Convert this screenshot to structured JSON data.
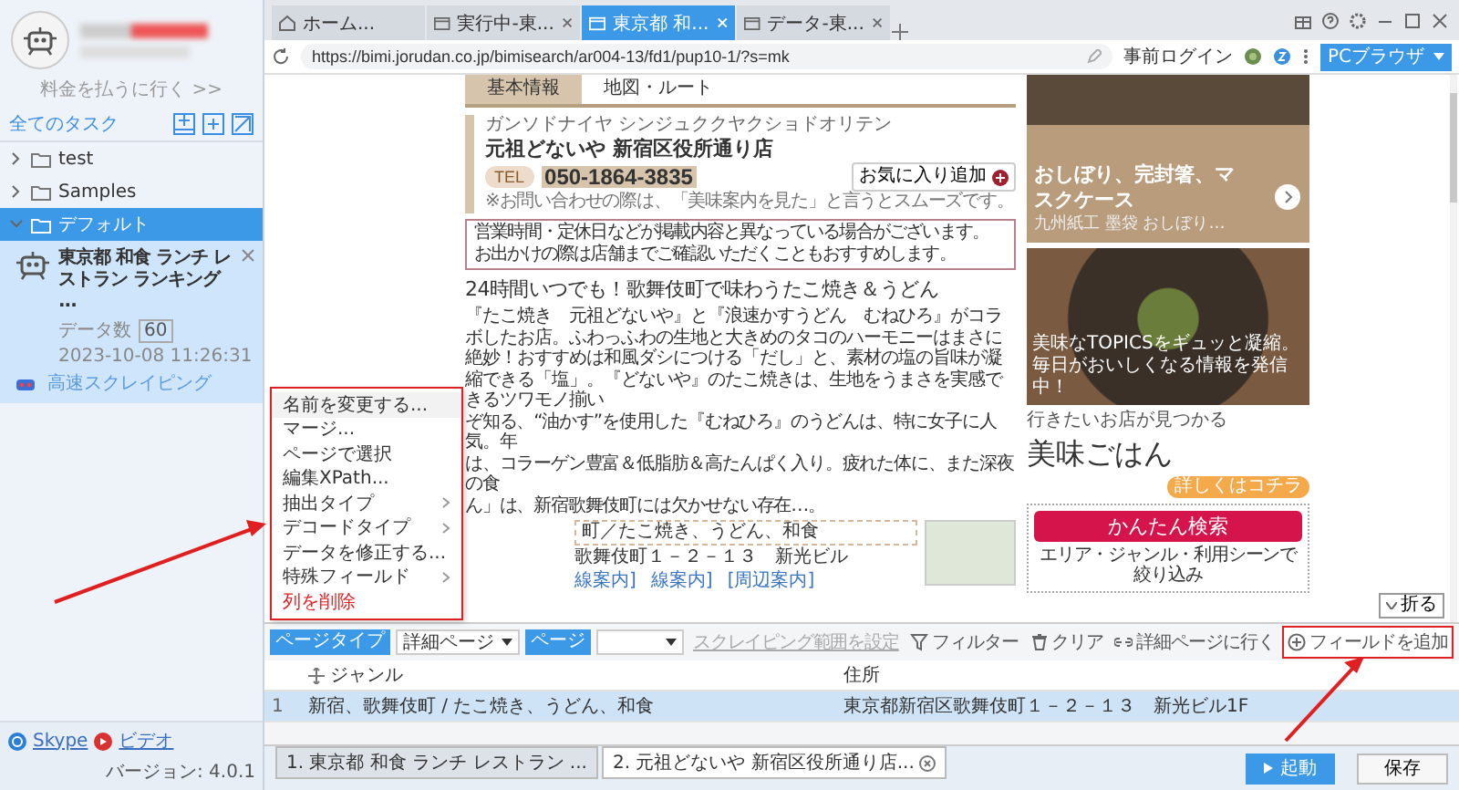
{
  "sidebar": {
    "upgrade_link": "料金を払うに行く >>",
    "all_tasks": "全てのタスク",
    "tree": [
      {
        "label": "test",
        "expanded": false,
        "selected": false
      },
      {
        "label": "Samples",
        "expanded": false,
        "selected": false
      },
      {
        "label": "デフォルト",
        "expanded": true,
        "selected": true,
        "children": [
          {
            "title": "東京都 和食 ランチ レストラン ランキング ...",
            "data_label": "データ数",
            "data_count": "60",
            "time": "2023-10-08 11:26:31",
            "mode": "高速スクレイピング"
          }
        ]
      }
    ],
    "footer": {
      "skype": "Skype",
      "video": "ビデオ",
      "version": "バージョン: 4.0.1"
    }
  },
  "browser": {
    "tabs": [
      {
        "label": "ホーム...",
        "kind": "home",
        "selected": false,
        "closable": false
      },
      {
        "label": "実行中-東...",
        "kind": "page",
        "selected": false,
        "closable": true
      },
      {
        "label": "東京都 和...",
        "kind": "page",
        "selected": true,
        "closable": true
      },
      {
        "label": "データ-東...",
        "kind": "page",
        "selected": false,
        "closable": true
      }
    ],
    "url": "https://bimi.jorudan.co.jp/bimisearch/ar004-13/fd1/pup10-1/?s=mk",
    "prelogin": "事前ログイン",
    "mode_button": "PCブラウザ"
  },
  "page": {
    "tabs": [
      {
        "label": "基本情報",
        "selected": true
      },
      {
        "label": "地図・ルート",
        "selected": false
      }
    ],
    "kana": "ガンソドナイヤ シンジュククヤクショドオリテン",
    "name": "元祖どないや 新宿区役所通り店",
    "tel_label": "TEL",
    "tel": "050-1864-3835",
    "tel_note": "※お問い合わせの際は、「美味案内を見た」と言うとスムーズです。",
    "favorite_button": "お気に入り追加",
    "notice": [
      "営業時間・定休日などが掲載内容と異なっている場合がございます。",
      "お出かけの際は店舗までご確認いただくこともおすすめします。"
    ],
    "headline": "24時間いつでも！歌舞伎町で味わうたこ焼き＆うどん",
    "description": "『たこ焼き　元祖どないや』と『浪速かすうどん　むねひろ』がコラボしたお店。ふわっふわの生地と大きめのタコのハーモニーはまさに絶妙！おすすめは和風ダシにつける「だし」と、素材の塩の旨味が凝縮できる「塩」。『どないや』のたこ焼きは、生地をうまさを実感できるツワモノ揃い",
    "description_fragments": [
      "ぞ知る、“油かす”を使用した『むねひろ』のうどんは、特に女子に人気。年",
      "は、コラーゲン豊富＆低脂肪＆高たんぱく入り。疲れた体に、また深夜の食",
      "ん」は、新宿歌舞伎町には欠かせない存在…。"
    ],
    "info": {
      "genre": "町／たこ焼き、うどん、和食",
      "address": "歌舞伎町１－２－１３　新光ビル",
      "links": [
        "線案内]",
        "線案内]",
        "[周辺案内]"
      ]
    },
    "promo": {
      "title": "おしぼり、完封箸、マスクケース",
      "subtitle": "九州紙工 墨袋 おしぼり…"
    },
    "topics": {
      "caption": "美味なTOPICSをギュッと凝縮。毎日がおいしくなる情報を発信中！"
    },
    "finder": {
      "tagline": "行きたいお店が見つかる",
      "brand": "美味ごはん",
      "badge": "詳しくはコチラ",
      "search_button": "かんたん検索",
      "search_note": "エリア・ジャンル・利用シーンで絞り込み"
    },
    "fold_button": "折る"
  },
  "data_panel": {
    "page_type_label": "ページタイプ",
    "page_type_value": "詳細ページ",
    "second_label": "ページ",
    "scope_link": "スクレイピング範囲を設定",
    "actions": [
      {
        "label": "フィルター",
        "kind": "filter",
        "highlighted": false
      },
      {
        "label": "クリア",
        "kind": "clear",
        "highlighted": false
      },
      {
        "label": "詳細ページに行く",
        "kind": "link",
        "highlighted": false
      },
      {
        "label": "フィールドを追加",
        "kind": "add",
        "highlighted": true
      }
    ],
    "columns": [
      "ジャンル",
      "住所"
    ],
    "rows": [
      {
        "index": "1",
        "cells": [
          "新宿、歌舞伎町 / たこ焼き、うどん、和食",
          "東京都新宿区歌舞伎町１－２－１３　新光ビル1F"
        ],
        "selected": true
      }
    ]
  },
  "context_menu": [
    {
      "label": "名前を変更する...",
      "submenu": false,
      "danger": false,
      "selected": true
    },
    {
      "label": "マージ...",
      "submenu": false,
      "danger": false,
      "selected": false
    },
    {
      "label": "ページで選択",
      "submenu": false,
      "danger": false,
      "selected": false
    },
    {
      "label": "編集XPath...",
      "submenu": false,
      "danger": false,
      "selected": false
    },
    {
      "label": "抽出タイプ",
      "submenu": true,
      "danger": false,
      "selected": false
    },
    {
      "label": "デコードタイプ",
      "submenu": true,
      "danger": false,
      "selected": false
    },
    {
      "label": "データを修正する...",
      "submenu": false,
      "danger": false,
      "selected": false
    },
    {
      "label": "特殊フィールド",
      "submenu": true,
      "danger": false,
      "selected": false
    },
    {
      "label": "列を削除",
      "submenu": false,
      "danger": true,
      "selected": false
    }
  ],
  "run_tabs": [
    {
      "label": "1. 東京都 和食 ランチ レストラン ...",
      "selected": false,
      "closable": false
    },
    {
      "label": "2. 元祖どないや 新宿区役所通り店...",
      "selected": true,
      "closable": true
    }
  ],
  "buttons": {
    "start": "起動",
    "save": "保存"
  }
}
